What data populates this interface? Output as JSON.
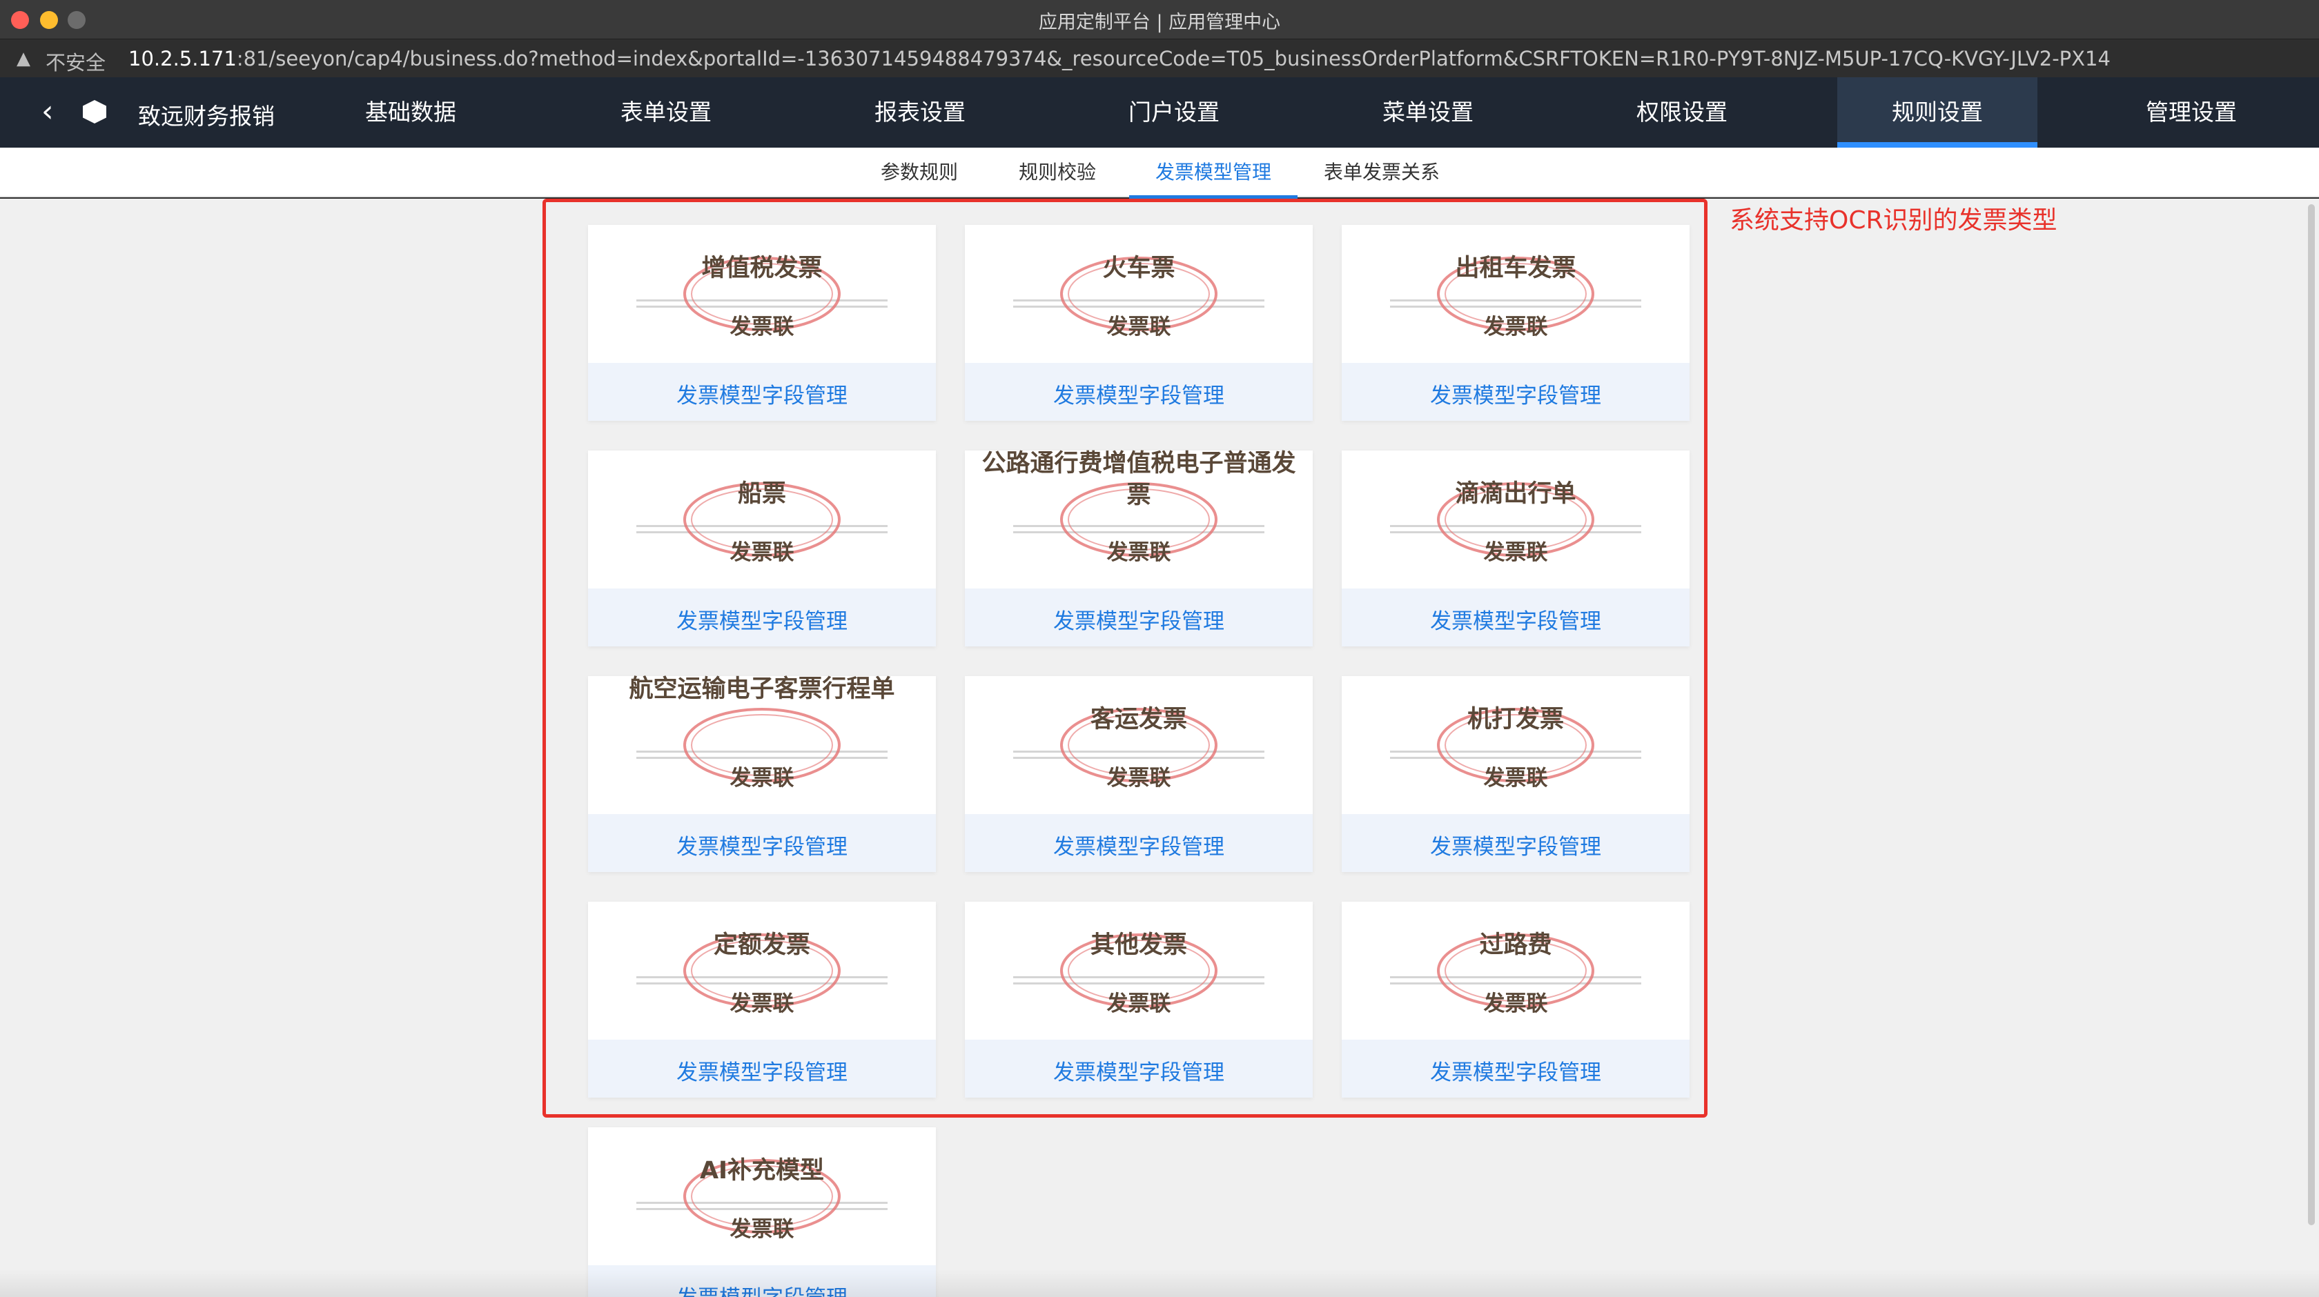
{
  "window": {
    "title": "应用定制平台 | 应用管理中心"
  },
  "urlbar": {
    "security_label": "不安全",
    "url_host": "10.2.5.171",
    "url_rest": ":81/seeyon/cap4/business.do?method=index&portalId=-1363071459488479374&_resourceCode=T05_businessOrderPlatform&CSRFTOKEN=R1R0-PY9T-8NJZ-M5UP-17CQ-KVGY-JLV2-PX14"
  },
  "topnav": {
    "app_name": "致远财务报销",
    "items": [
      {
        "label": "基础数据"
      },
      {
        "label": "表单设置"
      },
      {
        "label": "报表设置"
      },
      {
        "label": "门户设置"
      },
      {
        "label": "菜单设置"
      },
      {
        "label": "权限设置"
      },
      {
        "label": "规则设置",
        "active": true
      },
      {
        "label": "管理设置"
      }
    ]
  },
  "subtabs": [
    {
      "label": "参数规则"
    },
    {
      "label": "规则校验"
    },
    {
      "label": "发票模型管理",
      "active": true
    },
    {
      "label": "表单发票关系"
    }
  ],
  "annotation": "系统支持OCR识别的发票类型",
  "stamp_label": "发票联",
  "card_link_label": "发票模型字段管理",
  "cards": [
    {
      "title": "增值税发票"
    },
    {
      "title": "火车票"
    },
    {
      "title": "出租车发票"
    },
    {
      "title": "船票"
    },
    {
      "title": "公路通行费增值税电子普通发票"
    },
    {
      "title": "滴滴出行单"
    },
    {
      "title": "航空运输电子客票行程单"
    },
    {
      "title": "客运发票"
    },
    {
      "title": "机打发票"
    },
    {
      "title": "定额发票"
    },
    {
      "title": "其他发票"
    },
    {
      "title": "过路费"
    },
    {
      "title": "AI补充模型"
    }
  ],
  "colors": {
    "nav_bg": "#1f2733",
    "nav_active_bar": "#2f8fff",
    "link_blue": "#1f7ae0",
    "annotation_red": "#e8322b",
    "stamp_red": "#e57373"
  }
}
